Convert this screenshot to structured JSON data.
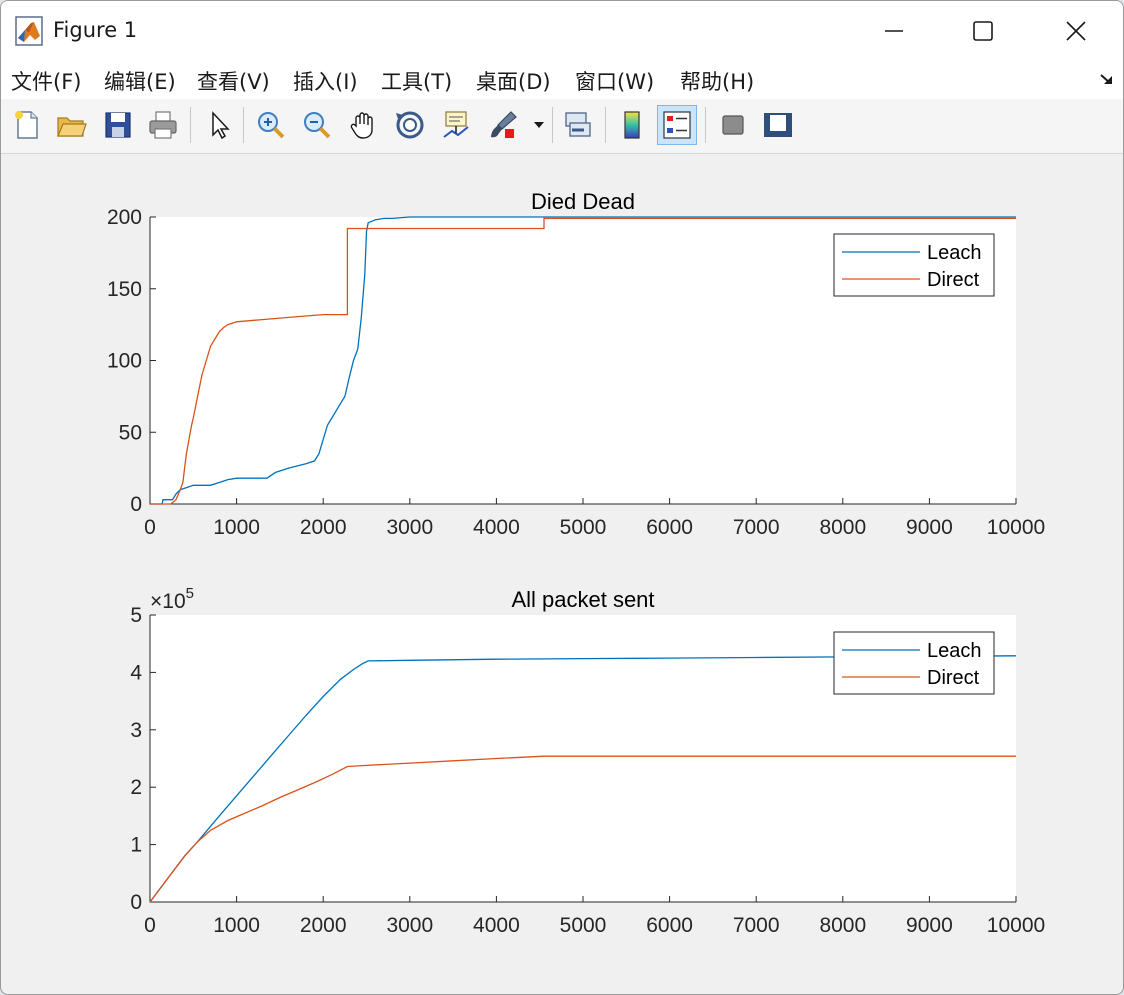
{
  "window": {
    "title": "Figure 1"
  },
  "menu": {
    "items": [
      {
        "label": "文件(F)",
        "name": "menu-file"
      },
      {
        "label": "编辑(E)",
        "name": "menu-edit"
      },
      {
        "label": "查看(V)",
        "name": "menu-view"
      },
      {
        "label": "插入(I)",
        "name": "menu-insert"
      },
      {
        "label": "工具(T)",
        "name": "menu-tools"
      },
      {
        "label": "桌面(D)",
        "name": "menu-desktop"
      },
      {
        "label": "窗口(W)",
        "name": "menu-window"
      },
      {
        "label": "帮助(H)",
        "name": "menu-help"
      }
    ]
  },
  "toolbar": {
    "buttons": [
      {
        "name": "new-figure-icon"
      },
      {
        "name": "open-file-icon"
      },
      {
        "name": "save-icon"
      },
      {
        "name": "print-icon"
      },
      {
        "name": "edit-plot-arrow-icon"
      },
      {
        "name": "zoom-in-icon"
      },
      {
        "name": "zoom-out-icon"
      },
      {
        "name": "pan-hand-icon"
      },
      {
        "name": "rotate-3d-icon"
      },
      {
        "name": "data-cursor-icon"
      },
      {
        "name": "brush-icon"
      },
      {
        "name": "link-plot-icon"
      },
      {
        "name": "colorbar-icon"
      },
      {
        "name": "legend-icon"
      },
      {
        "name": "hide-plot-tools-icon"
      },
      {
        "name": "show-plot-tools-icon"
      }
    ]
  },
  "colors": {
    "leach": "#0072bd",
    "direct": "#d95319"
  },
  "chart_data": [
    {
      "type": "line",
      "title": "Died Dead",
      "xlim": [
        0,
        10000
      ],
      "ylim": [
        0,
        200
      ],
      "xticks": [
        "0",
        "1000",
        "2000",
        "3000",
        "4000",
        "5000",
        "6000",
        "7000",
        "8000",
        "9000",
        "10000"
      ],
      "yticks": [
        "0",
        "50",
        "100",
        "150",
        "200"
      ],
      "legend": {
        "position": "top-right",
        "entries": [
          "Leach",
          "Direct"
        ]
      },
      "grid": false,
      "series": [
        {
          "name": "Leach",
          "x": [
            0,
            140,
            150,
            260,
            300,
            350,
            400,
            500,
            700,
            800,
            900,
            1000,
            1200,
            1350,
            1450,
            1600,
            1800,
            1900,
            1950,
            2000,
            2050,
            2100,
            2150,
            2200,
            2250,
            2300,
            2350,
            2400,
            2440,
            2480,
            2500,
            2520,
            2560,
            2600,
            2700,
            2800,
            3000,
            10000
          ],
          "y": [
            0,
            0,
            3,
            3,
            7,
            10,
            11,
            13,
            13,
            15,
            17,
            18,
            18,
            18,
            22,
            25,
            28,
            30,
            35,
            45,
            55,
            60,
            65,
            70,
            75,
            88,
            100,
            108,
            130,
            160,
            190,
            196,
            197,
            198,
            199,
            199,
            200,
            200
          ]
        },
        {
          "name": "Direct",
          "x": [
            0,
            240,
            300,
            350,
            380,
            400,
            420,
            450,
            480,
            500,
            550,
            600,
            650,
            700,
            750,
            800,
            850,
            900,
            1000,
            1200,
            1400,
            1600,
            2000,
            2280,
            2280,
            4550,
            4550,
            10000
          ],
          "y": [
            0,
            0,
            3,
            10,
            15,
            25,
            35,
            45,
            55,
            60,
            75,
            90,
            100,
            110,
            115,
            120,
            123,
            125,
            127,
            128,
            129,
            130,
            132,
            132,
            192,
            192,
            199,
            199
          ]
        }
      ]
    },
    {
      "type": "line",
      "title": "All packet sent",
      "exponent_label": "×10",
      "exponent_power": "5",
      "xlim": [
        0,
        10000
      ],
      "ylim": [
        0,
        5
      ],
      "xticks": [
        "0",
        "1000",
        "2000",
        "3000",
        "4000",
        "5000",
        "6000",
        "7000",
        "8000",
        "9000",
        "10000"
      ],
      "yticks": [
        "0",
        "1",
        "2",
        "3",
        "4",
        "5"
      ],
      "legend": {
        "position": "top-right",
        "entries": [
          "Leach",
          "Direct"
        ]
      },
      "grid": false,
      "series": [
        {
          "name": "Leach",
          "x": [
            0,
            200,
            400,
            550,
            800,
            1000,
            1200,
            1400,
            1600,
            1800,
            2000,
            2200,
            2350,
            2450,
            2520,
            3000,
            4000,
            5000,
            6000,
            7000,
            8000,
            9000,
            10000
          ],
          "y": [
            0,
            0.4,
            0.8,
            1.05,
            1.5,
            1.85,
            2.2,
            2.55,
            2.9,
            3.25,
            3.58,
            3.88,
            4.05,
            4.15,
            4.2,
            4.21,
            4.23,
            4.24,
            4.25,
            4.26,
            4.27,
            4.28,
            4.29
          ]
        },
        {
          "name": "Direct",
          "x": [
            0,
            200,
            400,
            550,
            700,
            900,
            1100,
            1300,
            1500,
            1700,
            1900,
            2100,
            2280,
            2500,
            3000,
            3500,
            4000,
            4550,
            5000,
            6000,
            7000,
            8000,
            9000,
            10000
          ],
          "y": [
            0,
            0.4,
            0.8,
            1.05,
            1.25,
            1.42,
            1.55,
            1.68,
            1.82,
            1.95,
            2.08,
            2.22,
            2.36,
            2.38,
            2.42,
            2.46,
            2.5,
            2.54,
            2.54,
            2.54,
            2.54,
            2.54,
            2.54,
            2.54
          ]
        }
      ]
    }
  ]
}
